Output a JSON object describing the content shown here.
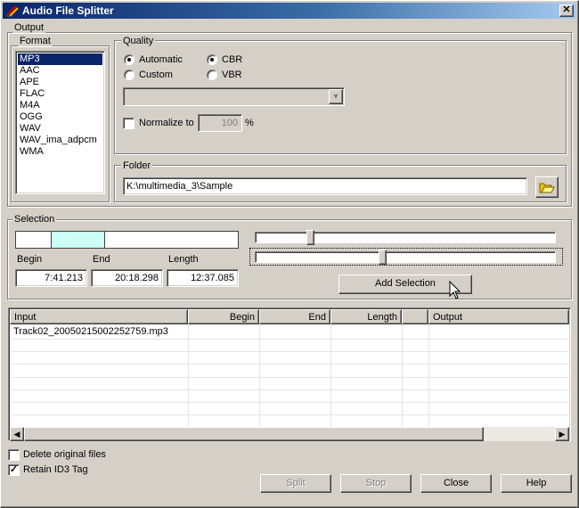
{
  "window": {
    "title": "Audio File Splitter",
    "close_glyph": "✕",
    "icon": "app-icon"
  },
  "output": {
    "group_label": "Output",
    "format": {
      "group_label": "Format",
      "items": [
        "MP3",
        "AAC",
        "APE",
        "FLAC",
        "M4A",
        "OGG",
        "WAV",
        "WAV_ima_adpcm",
        "WMA"
      ],
      "selected": "MP3"
    },
    "quality": {
      "group_label": "Quality",
      "automatic_label": "Automatic",
      "custom_label": "Custom",
      "cbr_label": "CBR",
      "vbr_label": "VBR",
      "mode_selected": "Automatic",
      "bitrate_selected": "CBR",
      "combo_value": "",
      "normalize_label": "Normalize to",
      "normalize_checked": false,
      "normalize_value": "100",
      "percent_label": "%"
    },
    "folder": {
      "group_label": "Folder",
      "path": "K:\\multimedia_3\\Sample",
      "browse_icon": "folder-open-icon"
    }
  },
  "selection": {
    "group_label": "Selection",
    "range_start_fraction": 0.157,
    "range_end_fraction": 0.402,
    "range_color": "#ccfff6",
    "begin_label": "Begin",
    "end_label": "End",
    "length_label": "Length",
    "begin_value": "7:41.213",
    "end_value": "20:18.298",
    "length_value": "12:37.085",
    "slider_begin_fraction": 0.17,
    "slider_end_fraction": 0.41,
    "add_button": "Add Selection"
  },
  "file_list": {
    "columns": [
      "Input",
      "Begin",
      "End",
      "Length",
      "",
      "Output"
    ],
    "rows": [
      {
        "input": "Track02_20050215002252759.mp3",
        "begin": "",
        "end": "",
        "length": "",
        "extra": "",
        "output": ""
      }
    ],
    "scroll_left_glyph": "◀",
    "scroll_right_glyph": "▶"
  },
  "options": {
    "delete_label": "Delete original files",
    "delete_checked": false,
    "retain_label": "Retain ID3 Tag",
    "retain_checked": true,
    "check_glyph": "✓"
  },
  "buttons": {
    "split": "Split",
    "stop": "Stop",
    "close": "Close",
    "help": "Help"
  },
  "colors": {
    "title_start": "#0a246a",
    "title_end": "#a6caf0",
    "face": "#d4d0c8",
    "selection_highlight": "#0a246a"
  }
}
